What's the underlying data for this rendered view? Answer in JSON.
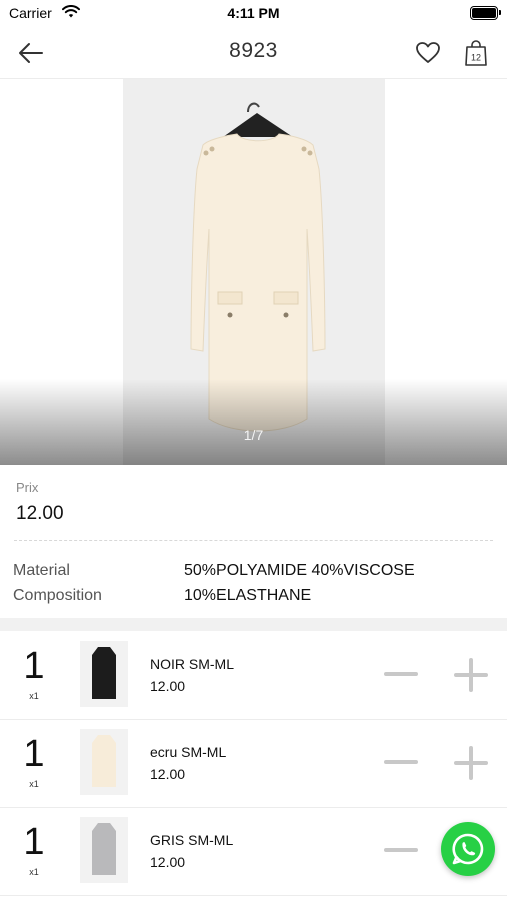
{
  "status_bar": {
    "carrier": "Carrier",
    "time": "4:11 PM"
  },
  "nav": {
    "title": "8923",
    "cart_count": "12"
  },
  "gallery": {
    "counter": "1/7"
  },
  "price": {
    "label": "Prix",
    "value": "12.00"
  },
  "material": {
    "label_line1": "Material",
    "label_line2": "Composition",
    "value_line1": "50%POLYAMIDE 40%VISCOSE",
    "value_line2": "10%ELASTHANE"
  },
  "variants": [
    {
      "qty": "1",
      "unit": "x1",
      "name": "NOIR SM-ML",
      "price": "12.00",
      "color": "#1c1c1c"
    },
    {
      "qty": "1",
      "unit": "x1",
      "name": "ecru SM-ML",
      "price": "12.00",
      "color": "#f7ecd9"
    },
    {
      "qty": "1",
      "unit": "x1",
      "name": "GRIS SM-ML",
      "price": "12.00",
      "color": "#b9b9bb"
    }
  ],
  "colors": {
    "accent_green": "#27d045",
    "dress_cream": "#f8eedd",
    "stepper_gray": "#c8c8c8"
  },
  "icons": [
    "wifi-icon",
    "battery-icon",
    "back-arrow-icon",
    "heart-icon",
    "shopping-bag-icon",
    "minus-icon",
    "plus-icon",
    "whatsapp-icon"
  ]
}
